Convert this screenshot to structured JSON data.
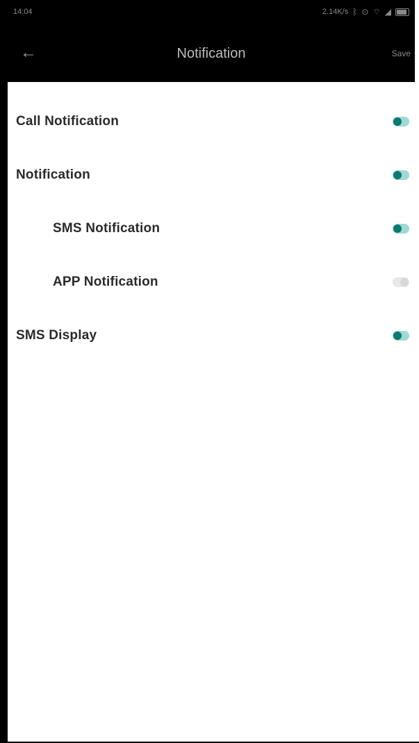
{
  "status_bar": {
    "time": "14:04",
    "network_speed": "2.14K/s"
  },
  "header": {
    "title": "Notification",
    "save_label": "Save"
  },
  "settings": [
    {
      "label": "Call Notification",
      "enabled": true
    },
    {
      "label": "Notification",
      "enabled": true
    },
    {
      "label": "SMS Notification",
      "enabled": true
    },
    {
      "label": "APP Notification",
      "enabled": false
    },
    {
      "label": "SMS Display",
      "enabled": true
    }
  ],
  "colors": {
    "toggle_on_track": "#9fd9d2",
    "toggle_on_knob": "#0a7a72",
    "header_bg": "#000000"
  },
  "icons": {
    "back": "arrow-left-icon"
  }
}
